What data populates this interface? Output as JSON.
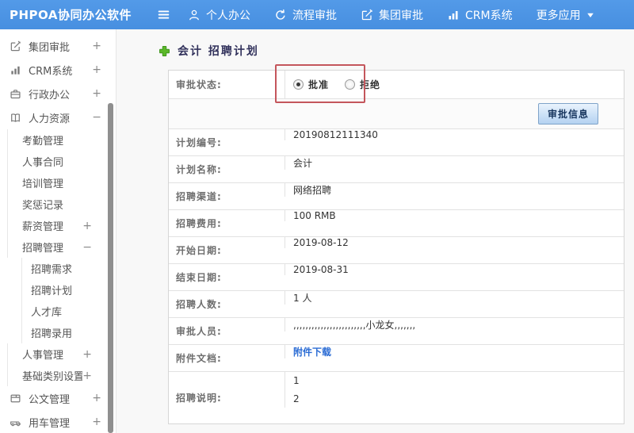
{
  "topbar": {
    "brand": "PHPOA协同办公软件",
    "nav": [
      {
        "label": "个人办公",
        "icon": "user-icon"
      },
      {
        "label": "流程审批",
        "icon": "process-icon"
      },
      {
        "label": "集团审批",
        "icon": "edit-square-icon"
      },
      {
        "label": "CRM系统",
        "icon": "bar-chart-icon"
      },
      {
        "label": "更多应用",
        "icon": null,
        "caret": true
      }
    ]
  },
  "sidebar": {
    "items": [
      {
        "label": "集团审批",
        "icon": "edit-square-icon",
        "level": 1,
        "toggle": "+"
      },
      {
        "label": "CRM系统",
        "icon": "bar-chart-icon",
        "level": 1,
        "toggle": "+"
      },
      {
        "label": "行政办公",
        "icon": "briefcase-icon",
        "level": 1,
        "toggle": "+"
      },
      {
        "label": "人力资源",
        "icon": "book-icon",
        "level": 1,
        "toggle": "−"
      },
      {
        "label": "考勤管理",
        "level": 2
      },
      {
        "label": "人事合同",
        "level": 2
      },
      {
        "label": "培训管理",
        "level": 2
      },
      {
        "label": "奖惩记录",
        "level": 2
      },
      {
        "label": "薪资管理",
        "level": 2,
        "toggle": "+"
      },
      {
        "label": "招聘管理",
        "level": 2,
        "toggle": "−"
      },
      {
        "label": "招聘需求",
        "level": 3
      },
      {
        "label": "招聘计划",
        "level": 3
      },
      {
        "label": "人才库",
        "level": 3
      },
      {
        "label": "招聘录用",
        "level": 3
      },
      {
        "label": "人事管理",
        "level": 2,
        "toggle": "+"
      },
      {
        "label": "基础类别设置",
        "level": 2,
        "toggle": "+"
      },
      {
        "label": "公文管理",
        "icon": "document-icon",
        "level": 1,
        "toggle": "+"
      },
      {
        "label": "用车管理",
        "icon": "car-icon",
        "level": 1,
        "toggle": "+"
      }
    ]
  },
  "breadcrumb": {
    "title": "会计 招聘计划"
  },
  "form": {
    "status_label": "审批状态:",
    "radio_approve": "批准",
    "radio_reject": "拒绝",
    "approve_selected": true,
    "approve_button": "审批信息",
    "rows": [
      {
        "label": "计划编号:",
        "value": "20190812111340",
        "type": "text"
      },
      {
        "label": "计划名称:",
        "value": "会计",
        "type": "text"
      },
      {
        "label": "招聘渠道:",
        "value": "网络招聘",
        "type": "text"
      },
      {
        "label": "招聘费用:",
        "value": "100 RMB",
        "type": "text"
      },
      {
        "label": "开始日期:",
        "value": "2019-08-12",
        "type": "text"
      },
      {
        "label": "结束日期:",
        "value": "2019-08-31",
        "type": "text"
      },
      {
        "label": "招聘人数:",
        "value": "1 人",
        "type": "text"
      },
      {
        "label": "审批人员:",
        "value": ",,,,,,,,,,,,,,,,,,,,,,,,小龙女,,,,,,,",
        "type": "text"
      },
      {
        "label": "附件文档:",
        "value": "附件下载",
        "type": "link"
      },
      {
        "label": "招聘说明:",
        "value_lines": [
          "1",
          "2"
        ],
        "type": "multiline"
      }
    ]
  },
  "colors": {
    "topbar_blue": "#4a92e4",
    "annotation_red": "#c4565c",
    "link_blue": "#2b6cd4",
    "plus_green": "#5cb829"
  }
}
